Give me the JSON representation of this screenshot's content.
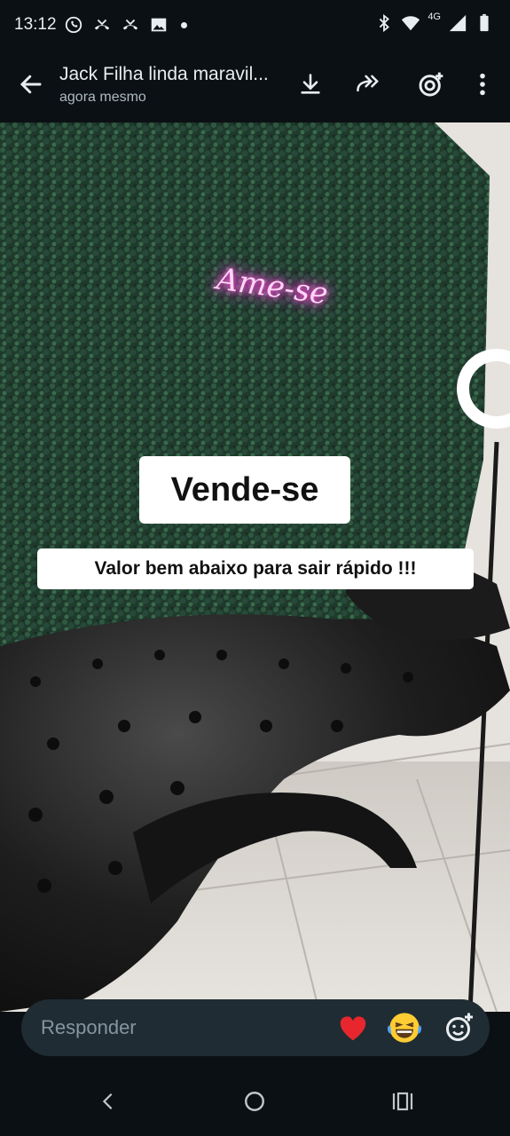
{
  "status_bar": {
    "time": "13:12",
    "network": "4G",
    "left_icons": [
      "whatsapp-icon",
      "missed-call-icon",
      "missed-call-icon",
      "gallery-icon",
      "dot-icon"
    ],
    "right_icons": [
      "bluetooth-icon",
      "wifi-icon",
      "signal-icon",
      "battery-icon"
    ]
  },
  "header": {
    "title": "Jack Filha linda maravil...",
    "subtitle": "agora mesmo",
    "actions": [
      "download-icon",
      "forward-icon",
      "add-status-icon",
      "more-options-icon"
    ]
  },
  "status_image": {
    "neon_sign": "Ame-se",
    "caption_big": "Vende-se",
    "caption_small": "Valor bem abaixo para sair rápido !!!"
  },
  "reply": {
    "placeholder": "Responder",
    "quick_reactions": [
      "heart-emoji",
      "laughing-emoji",
      "add-emoji-icon"
    ]
  },
  "colors": {
    "background": "#0b1014",
    "reply_bar": "#1f2c33",
    "text_secondary": "#aebac1"
  }
}
